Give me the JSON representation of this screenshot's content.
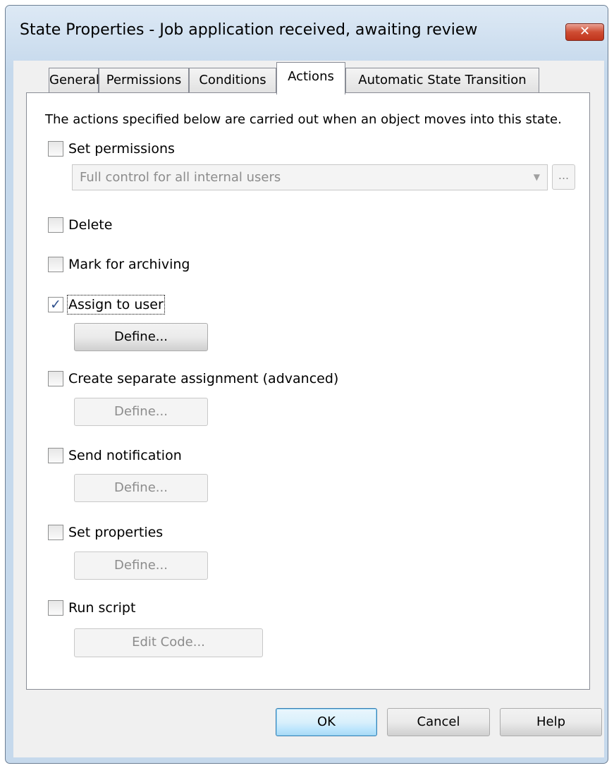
{
  "window": {
    "title": "State Properties - Job application received, awaiting review",
    "close_glyph": "✕"
  },
  "tabs": [
    {
      "label": "General",
      "active": false
    },
    {
      "label": "Permissions",
      "active": false
    },
    {
      "label": "Conditions",
      "active": false
    },
    {
      "label": "Actions",
      "active": true
    },
    {
      "label": "Automatic State Transition",
      "active": false
    }
  ],
  "panel": {
    "description": "The actions specified below are carried out when an object moves into this state.",
    "set_permissions": {
      "label": "Set permissions",
      "checked": false,
      "combo_value": "Full control for all internal users",
      "ellipsis_label": "..."
    },
    "delete": {
      "label": "Delete",
      "checked": false
    },
    "mark_for_archiving": {
      "label": "Mark for archiving",
      "checked": false
    },
    "assign_to_user": {
      "label": "Assign to user",
      "checked": true,
      "button_label": "Define..."
    },
    "create_separate_assignment": {
      "label": "Create separate assignment (advanced)",
      "checked": false,
      "button_label": "Define..."
    },
    "send_notification": {
      "label": "Send notification",
      "checked": false,
      "button_label": "Define..."
    },
    "set_properties": {
      "label": "Set properties",
      "checked": false,
      "button_label": "Define..."
    },
    "run_script": {
      "label": "Run script",
      "checked": false,
      "button_label": "Edit Code..."
    }
  },
  "footer": {
    "ok_label": "OK",
    "cancel_label": "Cancel",
    "help_label": "Help"
  },
  "icons": {
    "check": "✓",
    "dropdown": "▼"
  },
  "colors": {
    "titlebar": "#c6d9ec",
    "close_button": "#c7432a",
    "default_button": "#3c7fb1",
    "checkmark": "#2d4f8c"
  }
}
